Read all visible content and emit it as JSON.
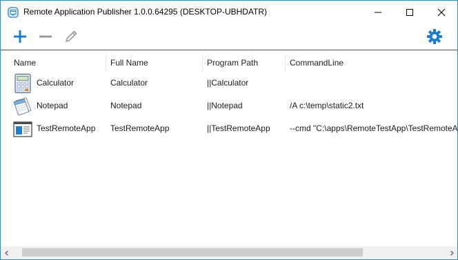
{
  "window": {
    "title": "Remote Application Publisher 1.0.0.64295 (DESKTOP-UBHDATR)",
    "controls": {
      "minimize": "minimize",
      "maximize": "maximize",
      "close": "close"
    }
  },
  "toolbar": {
    "add_icon": "plus-icon",
    "remove_icon": "minus-icon",
    "edit_icon": "pencil-icon",
    "settings_icon": "gear-icon",
    "accent_color": "#1a7dcf",
    "disabled_color": "#9a9a9a"
  },
  "list": {
    "columns": [
      "Name",
      "Full Name",
      "Program Path",
      "CommandLine"
    ],
    "rows": [
      {
        "icon": "calculator-icon",
        "name": "Calculator",
        "full_name": "Calculator",
        "program_path": "||Calculator",
        "command_line": ""
      },
      {
        "icon": "notepad-icon",
        "name": "Notepad",
        "full_name": "Notepad",
        "program_path": "||Notepad",
        "command_line": "/A c:\\temp\\static2.txt"
      },
      {
        "icon": "app-window-icon",
        "name": "TestRemoteApp",
        "full_name": "TestRemoteApp",
        "program_path": "||TestRemoteApp",
        "command_line": "--cmd \"C:\\apps\\RemoteTestApp\\TestRemoteApp.exe\""
      }
    ]
  },
  "scrollbar": {
    "horizontal_position": 0.0,
    "visible_fraction": 0.78
  },
  "colors": {
    "window_border": "#1f8fd6",
    "header_divider": "#4d4d4d"
  }
}
